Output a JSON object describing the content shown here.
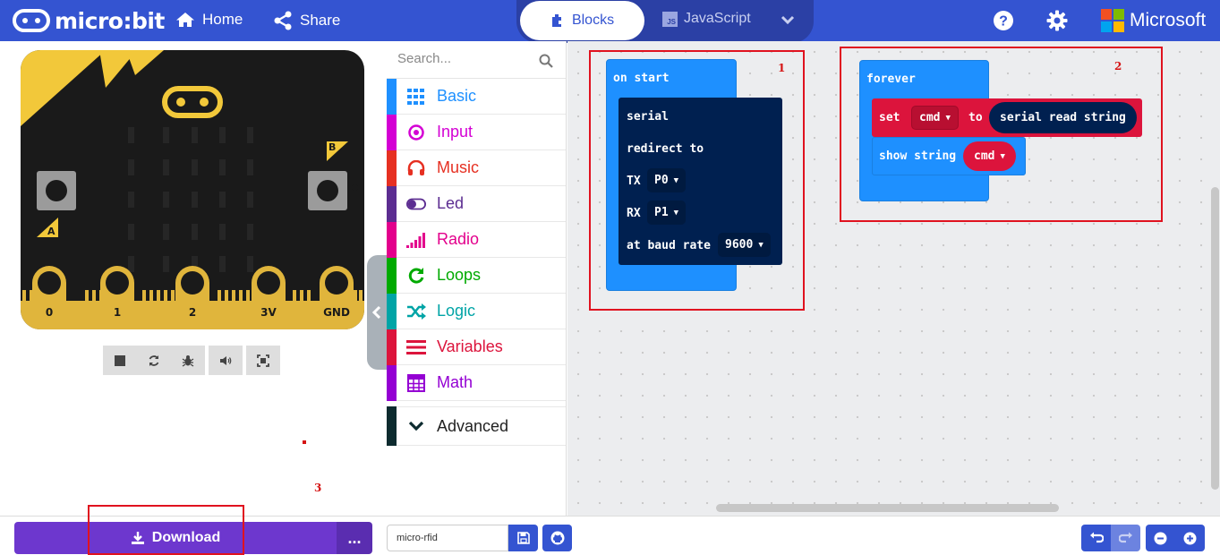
{
  "header": {
    "logo_text": "micro:bit",
    "home_label": "Home",
    "share_label": "Share",
    "blocks_label": "Blocks",
    "javascript_label": "JavaScript",
    "js_badge": "JS",
    "microsoft_label": "Microsoft",
    "accent_color": "#3454d1"
  },
  "simulator": {
    "button_a": "A",
    "button_b": "B",
    "pins": [
      "0",
      "1",
      "2",
      "3V",
      "GND"
    ],
    "controls": [
      "stop-icon",
      "restart-icon",
      "debug-icon",
      "sound-icon",
      "fullscreen-icon"
    ]
  },
  "toolbox": {
    "search_placeholder": "Search...",
    "categories": [
      {
        "label": "Basic",
        "color": "#1e90ff",
        "icon": "grid-icon"
      },
      {
        "label": "Input",
        "color": "#d400d4",
        "icon": "target-icon"
      },
      {
        "label": "Music",
        "color": "#e63022",
        "icon": "headphones-icon"
      },
      {
        "label": "Led",
        "color": "#5c2d91",
        "icon": "toggle-icon"
      },
      {
        "label": "Radio",
        "color": "#e3008c",
        "icon": "signal-icon"
      },
      {
        "label": "Loops",
        "color": "#00aa00",
        "icon": "loop-icon"
      },
      {
        "label": "Logic",
        "color": "#00a4a6",
        "icon": "shuffle-icon"
      },
      {
        "label": "Variables",
        "color": "#dc143c",
        "icon": "lines-icon"
      },
      {
        "label": "Math",
        "color": "#9400d3",
        "icon": "calculator-icon"
      }
    ],
    "advanced_label": "Advanced"
  },
  "workspace": {
    "on_start": {
      "hat": "on start",
      "serial": "serial",
      "redirect": "redirect to",
      "tx_label": "TX",
      "tx_value": "P0",
      "rx_label": "RX",
      "rx_value": "P1",
      "baud_label": "at baud rate",
      "baud_value": "9600"
    },
    "forever": {
      "hat": "forever",
      "set": "set",
      "var": "cmd",
      "to": "to",
      "read": "serial read string",
      "show": "show string",
      "show_var": "cmd"
    },
    "markers": [
      "1",
      "2",
      "3"
    ]
  },
  "footer": {
    "download_label": "Download",
    "more_label": "...",
    "project_name": "micro-rfid"
  }
}
